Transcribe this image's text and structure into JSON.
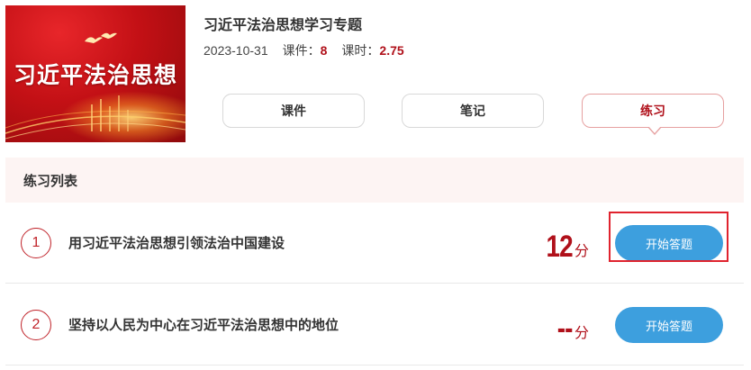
{
  "banner": {
    "title": "习近平法治思想"
  },
  "course": {
    "title": "习近平法治思想学习专题",
    "date": "2023-10-31",
    "lessons_label": "课件：",
    "lessons_value": "8",
    "hours_label": "课时：",
    "hours_value": "2.75"
  },
  "tabs": [
    {
      "label": "课件",
      "active": false
    },
    {
      "label": "笔记",
      "active": false
    },
    {
      "label": "练习",
      "active": true
    }
  ],
  "list": {
    "header": "练习列表",
    "items": [
      {
        "index": "1",
        "title": "用习近平法治思想引领法治中国建设",
        "score": "12",
        "unit": "分",
        "button": "开始答题",
        "highlighted": true
      },
      {
        "index": "2",
        "title": "坚持以人民为中心在习近平法治思想中的地位",
        "score": "--",
        "unit": "分",
        "button": "开始答题",
        "highlighted": false
      }
    ]
  },
  "colors": {
    "accent_red": "#b0101a",
    "button_blue": "#3d9fde",
    "highlight_border": "#e0232e",
    "header_bg": "#fdf4f3"
  }
}
